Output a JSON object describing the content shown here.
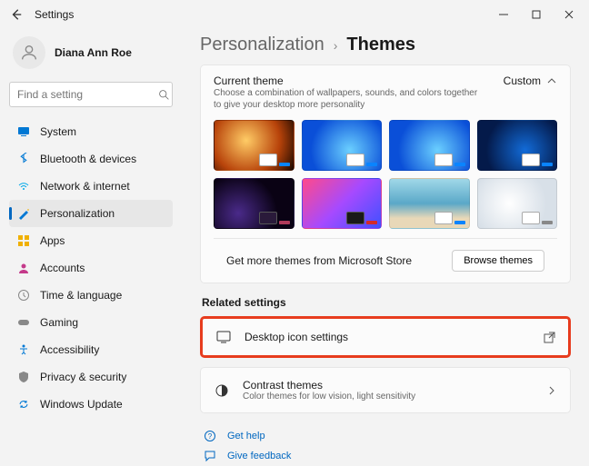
{
  "window": {
    "title": "Settings"
  },
  "profile": {
    "name": "Diana Ann Roe"
  },
  "search": {
    "placeholder": "Find a setting"
  },
  "sidebar": {
    "items": [
      {
        "label": "System",
        "color": "#0078d4"
      },
      {
        "label": "Bluetooth & devices",
        "color": "#0078d4"
      },
      {
        "label": "Network & internet",
        "color": "#00c8ff"
      },
      {
        "label": "Personalization",
        "color": "#0078d4"
      },
      {
        "label": "Apps",
        "color": "#f0b000"
      },
      {
        "label": "Accounts",
        "color": "#c43a8a"
      },
      {
        "label": "Time & language",
        "color": "#888888"
      },
      {
        "label": "Gaming",
        "color": "#888888"
      },
      {
        "label": "Accessibility",
        "color": "#0078d4"
      },
      {
        "label": "Privacy & security",
        "color": "#888888"
      },
      {
        "label": "Windows Update",
        "color": "#0078d4"
      }
    ]
  },
  "breadcrumb": {
    "parent": "Personalization",
    "current": "Themes"
  },
  "theme": {
    "title": "Current theme",
    "desc": "Choose a combination of wallpapers, sounds, and colors together to give your desktop more personality",
    "custom_label": "Custom",
    "store_text": "Get more themes from Microsoft Store",
    "browse_label": "Browse themes",
    "accents": [
      "#0a84ff",
      "#0a84ff",
      "#0a84ff",
      "#0a84ff",
      "#b03a5a",
      "#d42a2a",
      "#0a84ff",
      "#888888"
    ]
  },
  "related": {
    "title": "Related settings",
    "desktop_icons": "Desktop icon settings",
    "contrast_title": "Contrast themes",
    "contrast_desc": "Color themes for low vision, light sensitivity"
  },
  "links": {
    "help": "Get help",
    "feedback": "Give feedback"
  }
}
